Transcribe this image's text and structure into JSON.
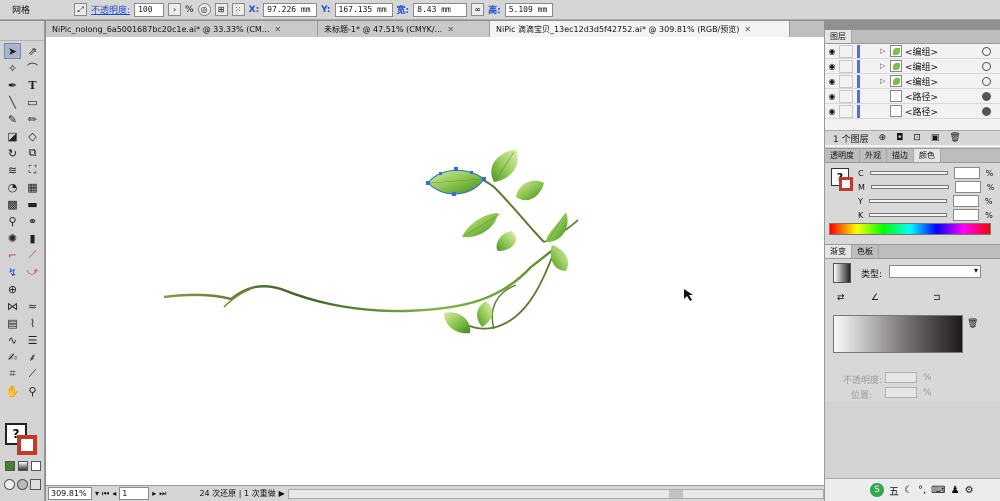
{
  "control_bar": {
    "mesh_label": "网格",
    "opacity_label": "不透明度:",
    "opacity_value": "100",
    "opacity_unit": "%",
    "x_label": "X:",
    "x_value": "97.226 mm",
    "y_label": "Y:",
    "y_value": "167.135 mm",
    "w_label": "宽:",
    "w_value": "8.43 mm",
    "h_label": "高:",
    "h_value": "5.109 mm"
  },
  "tabs": [
    {
      "label": "NiPic_nolong_6a5001687bc20c1e.ai* @ 33.33% (CM..."
    },
    {
      "label": "未标题-1* @ 47.51% (CMYK/..."
    },
    {
      "label": "NiPic 滴滴宝贝_13ec12d3d5f42752.ai* @ 309.81% (RGB/预览)"
    }
  ],
  "status": {
    "zoom": "309.81%",
    "page": "1",
    "history": "24 次还原 | 1 次重做"
  },
  "layers": {
    "tab": "图层",
    "rows": [
      {
        "name": "<编组>",
        "type": "group"
      },
      {
        "name": "<编组>",
        "type": "group"
      },
      {
        "name": "<编组>",
        "type": "group"
      },
      {
        "name": "<路径>",
        "type": "path"
      },
      {
        "name": "<路径>",
        "type": "path"
      }
    ],
    "footer": "1 个图层"
  },
  "color_panel": {
    "tabs": [
      "透明度",
      "外观",
      "描边",
      "颜色"
    ],
    "channels": [
      "C",
      "M",
      "Y",
      "K"
    ],
    "unit": "%"
  },
  "gradient_panel": {
    "tabs": [
      "渐变",
      "色板"
    ],
    "type_label": "类型:",
    "opacity_label": "不透明度:",
    "position_label": "位置:",
    "unit": "%"
  },
  "taskbar": {
    "ime": "五"
  },
  "colors": {
    "accent": "#4d6fe0",
    "leaf_light": "#a6d66b",
    "leaf_dark": "#5a9c2a",
    "stem": "#5e7a2e"
  }
}
